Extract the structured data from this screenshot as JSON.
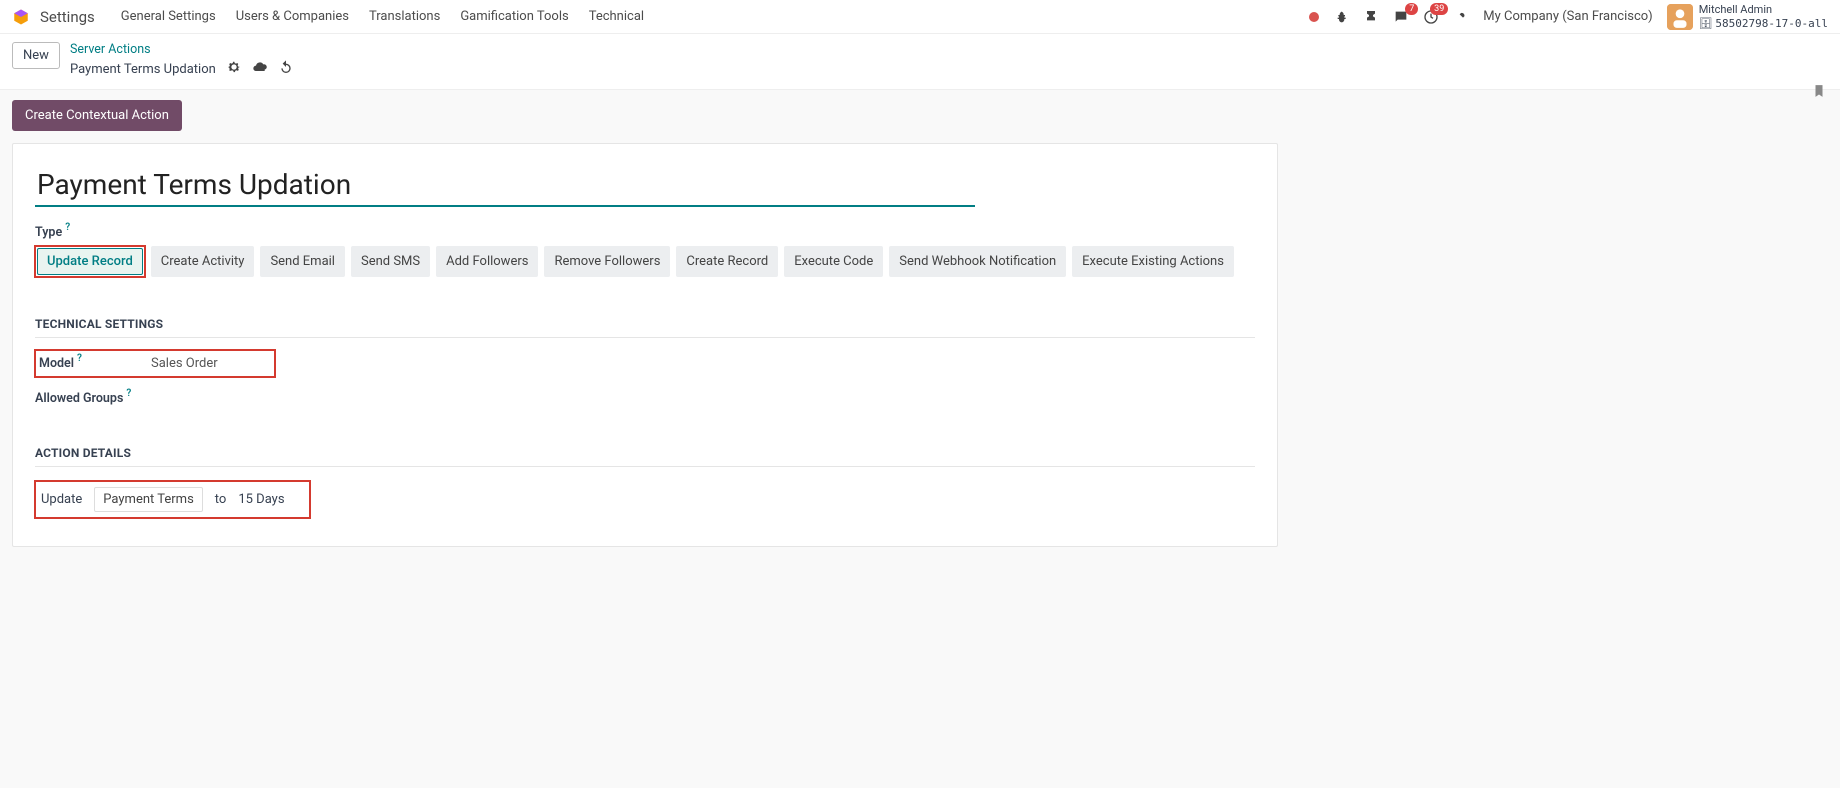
{
  "nav": {
    "app": "Settings",
    "menus": [
      "General Settings",
      "Users & Companies",
      "Translations",
      "Gamification Tools",
      "Technical"
    ],
    "company": "My Company (San Francisco)",
    "user_name": "Mitchell Admin",
    "db_line": "58502798-17-0-all",
    "msg_badge": "7",
    "activity_badge": "39"
  },
  "crumb": {
    "new_btn": "New",
    "parent": "Server Actions",
    "current": "Payment Terms Updation"
  },
  "buttons": {
    "contextual": "Create Contextual Action"
  },
  "form": {
    "title_value": "Payment Terms Updation",
    "type_label": "Type",
    "type_options": [
      "Update Record",
      "Create Activity",
      "Send Email",
      "Send SMS",
      "Add Followers",
      "Remove Followers",
      "Create Record",
      "Execute Code",
      "Send Webhook Notification",
      "Execute Existing Actions"
    ],
    "type_selected": "Update Record",
    "sections": {
      "tech": "TECHNICAL SETTINGS",
      "action": "ACTION DETAILS"
    },
    "model_label": "Model",
    "model_value": "Sales Order",
    "allowed_label": "Allowed Groups",
    "update_word": "Update",
    "update_field": "Payment Terms",
    "to_word": "to",
    "update_value": "15 Days"
  }
}
